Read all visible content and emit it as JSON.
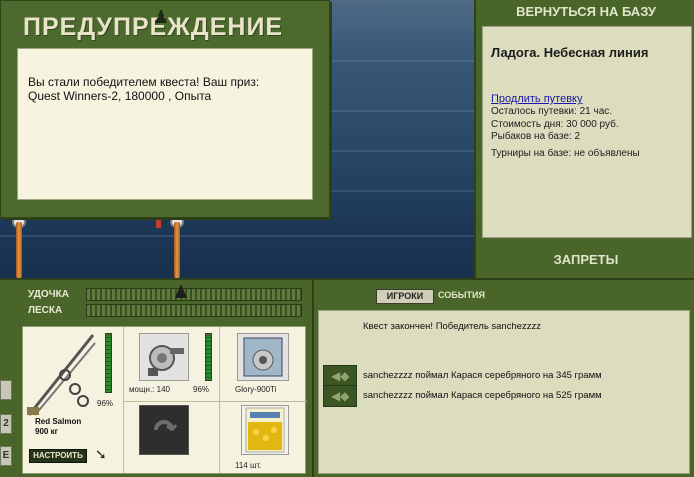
{
  "dialog": {
    "title": "ПРЕДУПРЕЖДЕНИЕ",
    "message_line1": "Вы стали победителем квеста! Ваш приз:",
    "message_line2": "Quest Winners-2, 180000 , Опыта",
    "title_icon": "fisherman-icon"
  },
  "right_panel": {
    "back_button": "ВЕРНУТЬСЯ НА БАЗУ",
    "base_name": "Ладога. Небесная линия",
    "extend_link": "Продлить путевку",
    "time_left": "Осталось путевки: 21 час.",
    "day_cost": "Стоимость дня: 30 000 руб.",
    "anglers": "Рыбаков на базе: 2",
    "tournaments": "Турниры на базе: не объявлены",
    "bans_button": "ЗАПРЕТЫ"
  },
  "meters": {
    "rod_label": "УДОЧКА",
    "line_label": "ЛЕСКА"
  },
  "edge_tabs": [
    "2",
    "Е"
  ],
  "tackle": {
    "rod_name": "Red Salmon",
    "rod_weight": "900 кг",
    "rod_level": "96%",
    "rod_level_value": 0.96,
    "reel_power": "мощн.: 140",
    "reel_level": "96%",
    "reel_level_value": 0.96,
    "line_name": "Glory-900Ti",
    "bait_count": "114 шт.",
    "tune_button": "НАСТРОИТЬ",
    "icons": {
      "rod": "fishing-rod-icon",
      "reel": "reel-icon",
      "line": "fishing-line-icon",
      "hook": "hook-icon",
      "bait": "bait-icon",
      "tune_arrow": "arrow-icon"
    }
  },
  "events": {
    "tab_players": "ИГРОКИ",
    "tab_events": "СОБЫТИЯ",
    "header": "Квест закончен! Победитель sanchezzzz",
    "items": [
      "sanchezzzz поймал Карася серебряного на 345 грамм",
      "sanchezzzz поймал Карася серебряного на 525 грамм"
    ]
  },
  "colors": {
    "panel_green": "#4a6529",
    "dialog_bg": "#f6f3df",
    "info_bg": "#dcdcbe",
    "water": "#2d4c6c",
    "link": "#1a1aa8"
  }
}
